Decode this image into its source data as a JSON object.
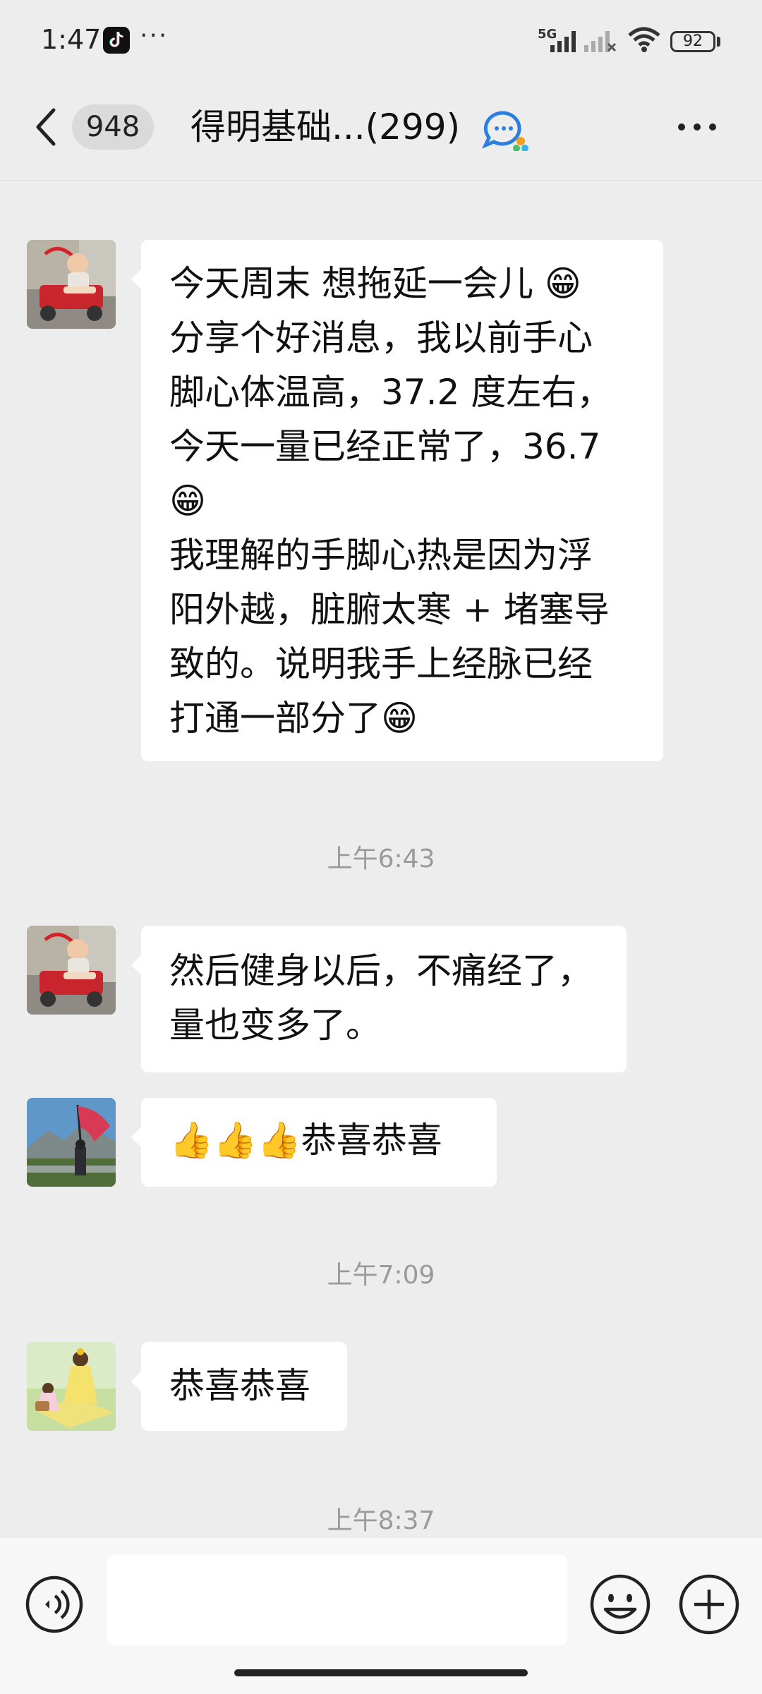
{
  "status_bar": {
    "time": "1:47",
    "overflow_dots": "···",
    "network": "5G",
    "battery": "92"
  },
  "nav": {
    "unread_count": "948",
    "title": "得明基础...(299)",
    "icons": [
      "back-arrow-icon",
      "group-chat-icon",
      "more-icon"
    ]
  },
  "messages": [
    {
      "sender_avatar": "baby-in-wagon",
      "lines": [
        "今天周末 想拖延一会儿 😁",
        "分享个好消息，我以前手心",
        "脚心体温高，37.2 度左右，",
        "今天一量已经正常了，36.7",
        "😁",
        "我理解的手脚心热是因为浮",
        "阳外越，脏腑太寒 + 堵塞导",
        "致的。说明我手上经脉已经",
        "打通一部分了😁"
      ]
    },
    {
      "timestamp": "上午6:43"
    },
    {
      "sender_avatar": "baby-in-wagon",
      "lines": [
        "然后健身以后，不痛经了，",
        "量也变多了。"
      ]
    },
    {
      "sender_avatar": "person-with-flag",
      "lines": [
        "👍👍👍恭喜恭喜"
      ]
    },
    {
      "timestamp": "上午7:09"
    },
    {
      "sender_avatar": "girls-picnic",
      "lines": [
        "恭喜恭喜"
      ]
    },
    {
      "timestamp": "上午8:37"
    }
  ],
  "input_bar": {
    "icons": [
      "voice-icon",
      "emoji-icon",
      "plus-icon"
    ]
  },
  "colors": {
    "background": "#ededed",
    "bubble": "#ffffff",
    "timestamp": "#9a9a9a"
  }
}
